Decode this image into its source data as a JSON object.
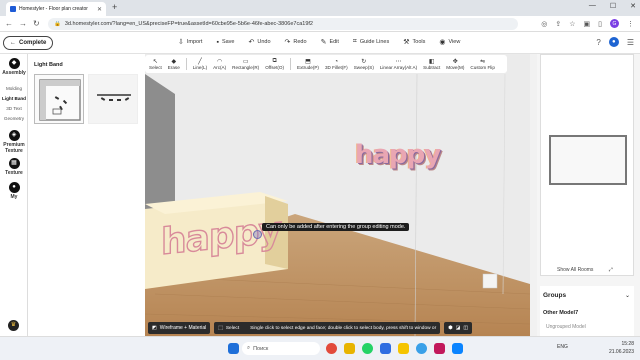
{
  "browser": {
    "tab_title": "Homestyler - Floor plan creator",
    "url": "3d.homestyler.com/?lang=en_US&preciseFP=true&assetId=60cbe95e-5b6e-46fe-abec-3806e7ca19f2",
    "avatar_letter": "G"
  },
  "app": {
    "complete_label": "Complete",
    "top_menu": [
      {
        "label": "Import",
        "icon": "import-icon"
      },
      {
        "label": "Save",
        "icon": "save-icon"
      },
      {
        "label": "Undo",
        "icon": "undo-icon"
      },
      {
        "label": "Redo",
        "icon": "redo-icon"
      },
      {
        "label": "Edit",
        "icon": "edit-icon"
      },
      {
        "label": "Guide Lines",
        "icon": "guide-lines-icon"
      },
      {
        "label": "Tools",
        "icon": "tools-icon"
      },
      {
        "label": "View",
        "icon": "view-icon"
      }
    ]
  },
  "sidebar": {
    "assembly": "Assembly",
    "subitems": [
      "Molding",
      "Light Band",
      "3D Text",
      "Geometry"
    ],
    "active_subitem": "Light Band",
    "premium_texture": "Premium Texture",
    "texture": "Texture",
    "my": "My"
  },
  "panel": {
    "title": "Light Band"
  },
  "toolbar": {
    "items": [
      {
        "label": "Select",
        "icon": "select-icon"
      },
      {
        "label": "Erase",
        "icon": "erase-icon"
      },
      {
        "label": "Line(L)",
        "icon": "line-icon"
      },
      {
        "label": "Arc(A)",
        "icon": "arc-icon"
      },
      {
        "label": "Rectangle(R)",
        "icon": "rectangle-icon"
      },
      {
        "label": "Offset(O)",
        "icon": "offset-icon"
      },
      {
        "label": "Extrude(P)",
        "icon": "extrude-icon"
      },
      {
        "label": "3D Fillet(F)",
        "icon": "fillet-icon"
      },
      {
        "label": "Sweep(S)",
        "icon": "sweep-icon"
      },
      {
        "label": "Linear Array(Alt A)",
        "icon": "linear-array-icon"
      },
      {
        "label": "Subtract",
        "icon": "subtract-icon"
      },
      {
        "label": "Move(M)",
        "icon": "move-icon"
      },
      {
        "label": "Custom Flip",
        "icon": "custom-flip-icon"
      }
    ]
  },
  "viewport": {
    "text_3d": "happy",
    "tooltip": "Can only be added after entering the group editing mode."
  },
  "bottombar": {
    "wireframe": "Wireframe + Material",
    "select": "Select",
    "hint": "Single click to select edge and face; double click to select body, press shift to window or"
  },
  "right_panel": {
    "show_all_rooms": "Show All Rooms",
    "groups_title": "Groups",
    "group_item": "Other Model7",
    "ungrouped": "Ungrouped Model"
  },
  "taskbar": {
    "search_placeholder": "Поиск",
    "language": "ENG",
    "time": "15:28",
    "date": "21.06.2023"
  },
  "colors": {
    "accent": "#1e64d2",
    "text3d_pink": "#e9a6b3",
    "text3d_purple": "#8a6a9e",
    "text3d_orange": "#f0b48a"
  }
}
